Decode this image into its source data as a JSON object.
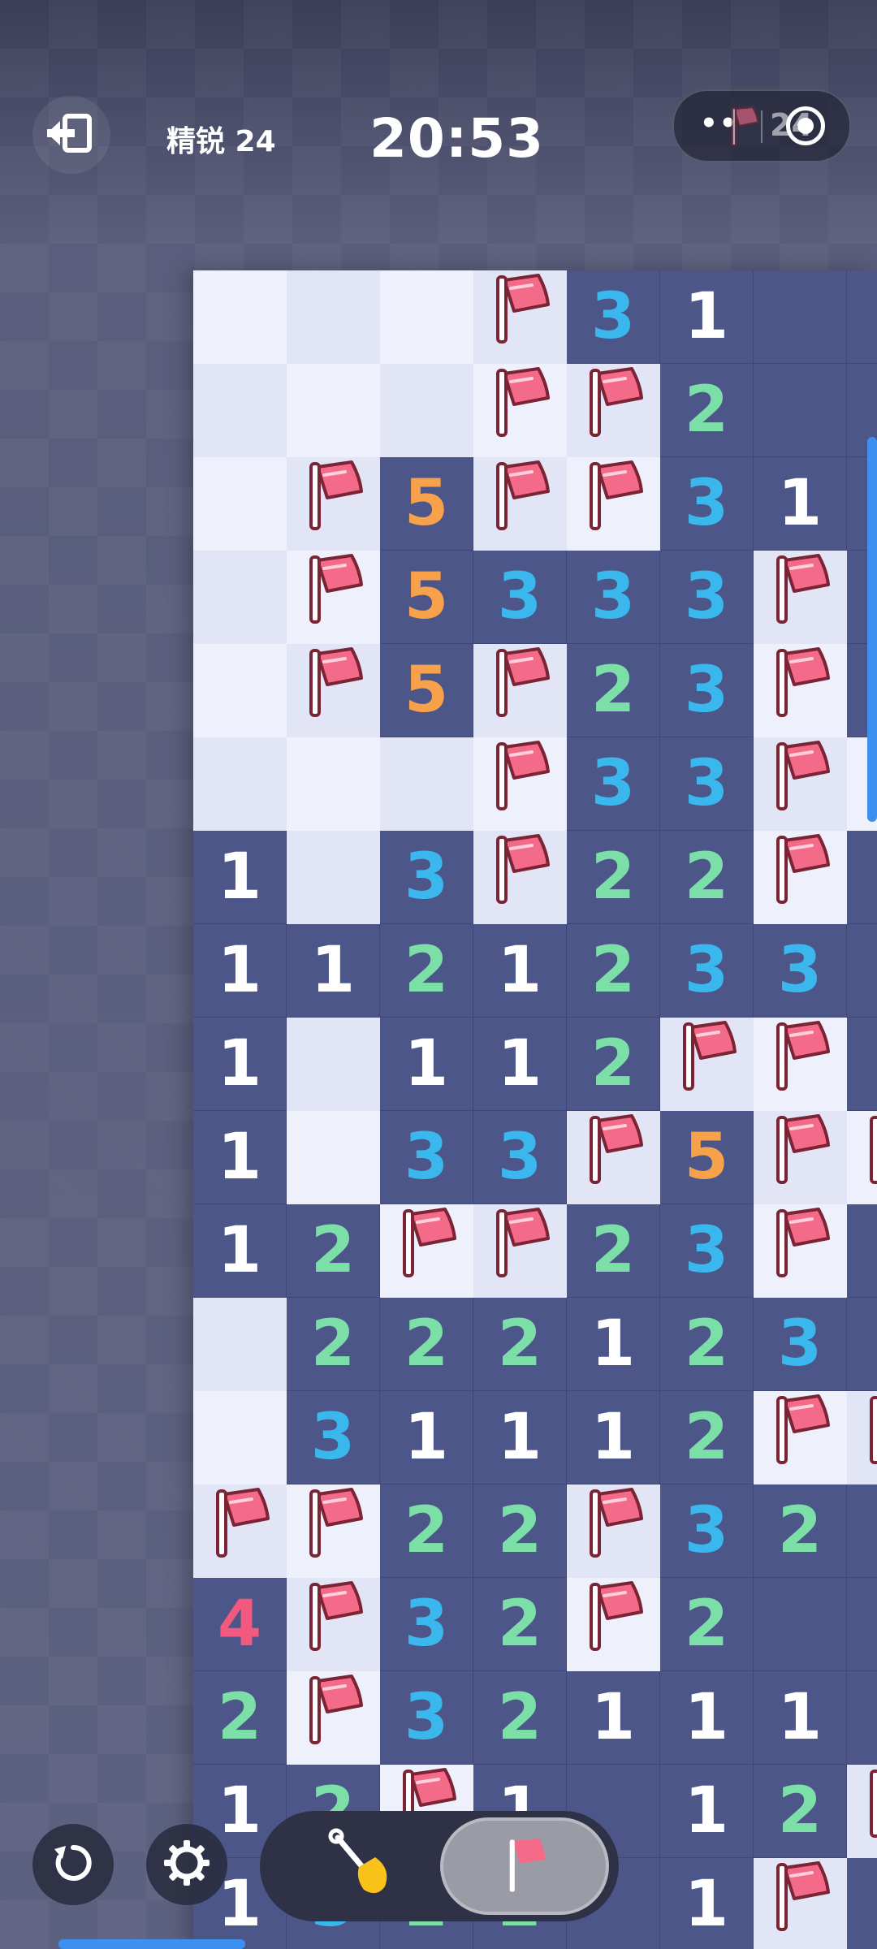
{
  "header": {
    "level": "精锐 24",
    "timer": "20:53",
    "capsule_more": "••",
    "flag_count": "24"
  },
  "colors": {
    "revealed": "#4c5688",
    "hidden_light": "#eef0fb",
    "hidden_dark": "#e1e5f6",
    "n1": "#ffffff",
    "n2": "#7ddfa8",
    "n3": "#3ab8ee",
    "n4": "#f3587f",
    "n5": "#f8a14b",
    "flag": "#f46b8a",
    "accent": "#3d8ff0"
  },
  "icons": {
    "exit": "exit-icon",
    "capsule_more": "more-icon",
    "capsule_close": "target-icon",
    "restart": "restart-icon",
    "settings": "gear-icon",
    "dig_mode": "shovel-icon",
    "flag_mode": "flag-icon"
  },
  "controls": {
    "active_mode": "flag"
  },
  "board": {
    "cols": 8,
    "legend": "H=hidden, F=flag, R=revealed empty, digit=revealed number",
    "rows": [
      [
        "H",
        "H",
        "H",
        "F",
        "3",
        "1",
        "R",
        "R"
      ],
      [
        "H",
        "H",
        "H",
        "F",
        "F",
        "2",
        "R",
        "R"
      ],
      [
        "H",
        "F",
        "5",
        "F",
        "F",
        "3",
        "1",
        "R"
      ],
      [
        "H",
        "F",
        "5",
        "3",
        "3",
        "3",
        "F",
        "R"
      ],
      [
        "H",
        "F",
        "5",
        "F",
        "2",
        "3",
        "F",
        "R"
      ],
      [
        "H",
        "H",
        "H",
        "F",
        "3",
        "3",
        "F",
        "F"
      ],
      [
        "1",
        "H",
        "3",
        "F",
        "2",
        "2",
        "F",
        "R"
      ],
      [
        "1",
        "1",
        "2",
        "1",
        "2",
        "3",
        "3",
        "R"
      ],
      [
        "1",
        "H",
        "1",
        "1",
        "2",
        "F",
        "F",
        "R"
      ],
      [
        "1",
        "H",
        "3",
        "3",
        "F",
        "5",
        "F",
        "F"
      ],
      [
        "1",
        "2",
        "F",
        "F",
        "2",
        "3",
        "F",
        "R"
      ],
      [
        "H",
        "2",
        "2",
        "2",
        "1",
        "2",
        "3",
        "R"
      ],
      [
        "H",
        "3",
        "1",
        "1",
        "1",
        "2",
        "F",
        "F"
      ],
      [
        "F",
        "F",
        "2",
        "2",
        "F",
        "3",
        "2",
        "R"
      ],
      [
        "4",
        "F",
        "3",
        "2",
        "F",
        "2",
        "R",
        "R"
      ],
      [
        "2",
        "F",
        "3",
        "2",
        "1",
        "1",
        "1",
        "R"
      ],
      [
        "1",
        "2",
        "F",
        "1",
        "R",
        "1",
        "2",
        "F"
      ],
      [
        "1",
        "3",
        "2",
        "2",
        "R",
        "1",
        "F",
        "R"
      ]
    ]
  }
}
